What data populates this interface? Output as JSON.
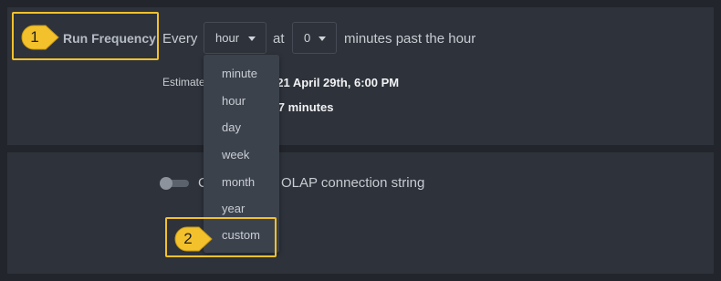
{
  "schedule": {
    "label": "Run Frequency",
    "every_label": "Every",
    "frequency_value": "hour",
    "at_label": "at",
    "minute_value": "0",
    "minutes_past_label": "minutes past the hour",
    "estimate_label": "Estimate",
    "estimate_value": "021 April 29th, 6:00 PM",
    "duration_value": "n 17 minutes"
  },
  "frequency_menu": {
    "items": [
      "minute",
      "hour",
      "day",
      "week",
      "month",
      "year",
      "custom"
    ]
  },
  "olap": {
    "label_start": "C",
    "label": "OLAP connection string",
    "enabled": false
  },
  "callouts": {
    "first": "1",
    "second": "2"
  },
  "colors": {
    "background": "#22252b",
    "panel": "#2e323a",
    "menu": "#3c424c",
    "callout": "#f3c12c"
  }
}
